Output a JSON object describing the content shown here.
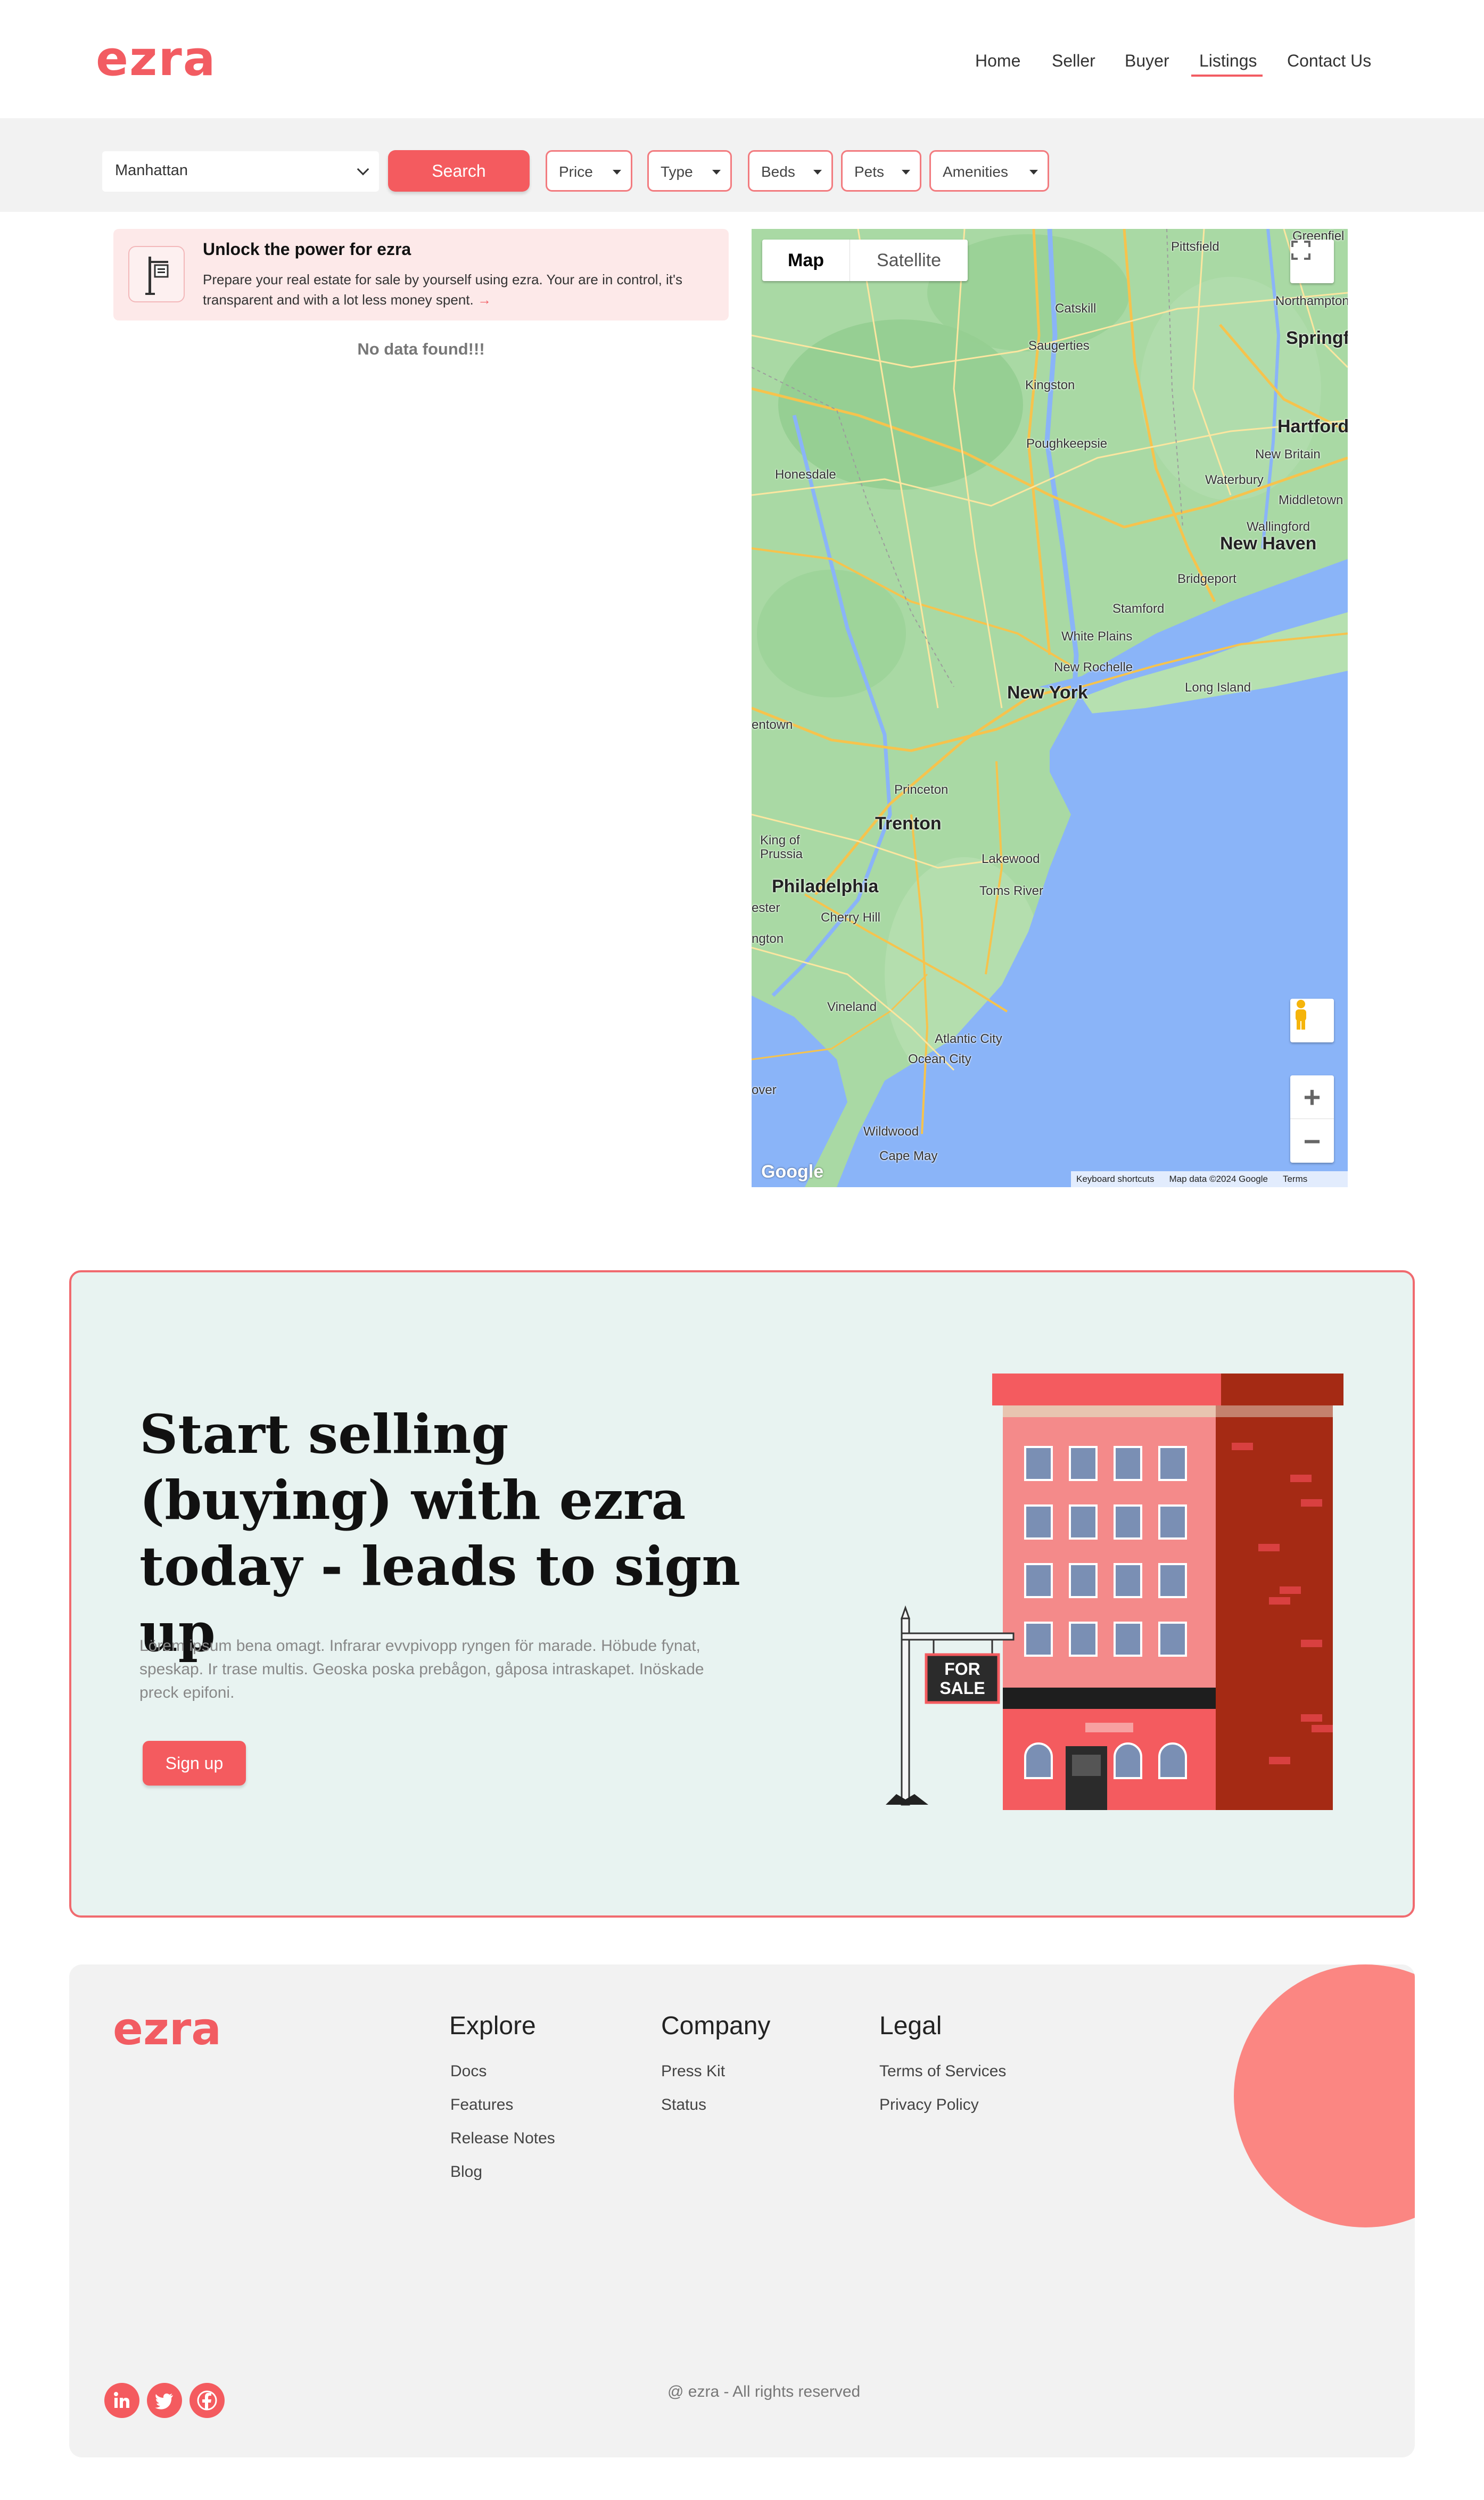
{
  "header": {
    "logo": "ezra",
    "nav": [
      {
        "label": "Home"
      },
      {
        "label": "Seller"
      },
      {
        "label": "Buyer"
      },
      {
        "label": "Listings",
        "active": true
      },
      {
        "label": "Contact Us"
      }
    ]
  },
  "filters": {
    "location": "Manhattan",
    "search_label": "Search",
    "dropdowns": [
      {
        "label": "Price"
      },
      {
        "label": "Type"
      },
      {
        "label": "Beds"
      },
      {
        "label": "Pets"
      },
      {
        "label": "Amenities"
      }
    ]
  },
  "promo": {
    "title": "Unlock the power for ezra",
    "description": "Prepare your real estate for sale by yourself using ezra. Your are in control, it's transparent and with a lot less money spent.",
    "arrow": "→"
  },
  "results": {
    "empty_message": "No data found!!!"
  },
  "map": {
    "tabs": [
      "Map",
      "Satellite"
    ],
    "active_tab": "Map",
    "zoom_in": "+",
    "zoom_out": "−",
    "attribution": {
      "google": "Google",
      "shortcuts": "Keyboard shortcuts",
      "data": "Map data ©2024 Google",
      "terms": "Terms"
    },
    "cities": [
      {
        "name": "New York",
        "big": true
      },
      {
        "name": "Philadelphia",
        "big": true
      },
      {
        "name": "Trenton",
        "big": true
      },
      {
        "name": "Hartford",
        "big": true
      },
      {
        "name": "New Haven",
        "big": true
      },
      {
        "name": "Springfie",
        "big": true
      },
      {
        "name": "Pittsfield"
      },
      {
        "name": "Greenfiel"
      },
      {
        "name": "Northampton"
      },
      {
        "name": "Catskill"
      },
      {
        "name": "Saugerties"
      },
      {
        "name": "Kingston"
      },
      {
        "name": "Poughkeepsie"
      },
      {
        "name": "New Britain"
      },
      {
        "name": "Waterbury"
      },
      {
        "name": "Middletown"
      },
      {
        "name": "Wallingford"
      },
      {
        "name": "Honesdale"
      },
      {
        "name": "Bridgeport"
      },
      {
        "name": "Stamford"
      },
      {
        "name": "White Plains"
      },
      {
        "name": "New Rochelle"
      },
      {
        "name": "Long Island"
      },
      {
        "name": "entown"
      },
      {
        "name": "Princeton"
      },
      {
        "name": "King of Prussia"
      },
      {
        "name": "Lakewood"
      },
      {
        "name": "Toms River"
      },
      {
        "name": "ester"
      },
      {
        "name": "Cherry Hill"
      },
      {
        "name": "ngton"
      },
      {
        "name": "Vineland"
      },
      {
        "name": "Atlantic City"
      },
      {
        "name": "Ocean City"
      },
      {
        "name": "over"
      },
      {
        "name": "Wildwood"
      },
      {
        "name": "Cape May"
      }
    ]
  },
  "cta": {
    "title": "Start selling (buying) with ezra today - leads to sign up",
    "description": "Lörem ipsum bena omagt. Infrarar evvpivopp ryngen för marade. Höbude fynat, speskap. Ir trase multis. Geoska poska prebågon, gåposa intraskapet. Inöskade preck epifoni.",
    "button": "Sign up",
    "sign_text_1": "FOR",
    "sign_text_2": "SALE",
    "colors": {
      "accent": "#f45b5f",
      "background": "#e8f3f1"
    }
  },
  "footer": {
    "logo": "ezra",
    "columns": [
      {
        "title": "Explore",
        "links": [
          "Docs",
          "Features",
          "Release Notes",
          "Blog"
        ]
      },
      {
        "title": "Company",
        "links": [
          "Press Kit",
          "Status"
        ]
      },
      {
        "title": "Legal",
        "links": [
          "Terms of Services",
          "Privacy Policy"
        ]
      }
    ],
    "social": [
      "linkedin-icon",
      "twitter-icon",
      "facebook-icon"
    ],
    "copyright": "@ ezra - All rights reserved"
  }
}
